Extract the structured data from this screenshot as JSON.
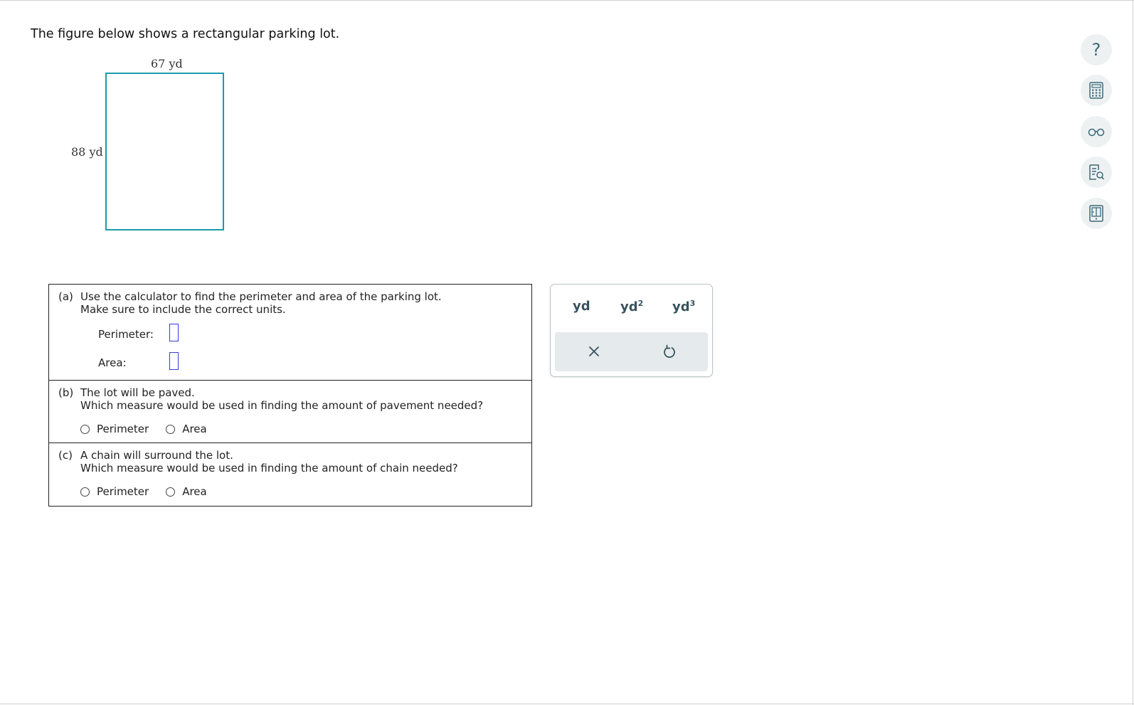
{
  "question": {
    "intro": "The figure below shows a rectangular parking lot."
  },
  "figure": {
    "width_label": "67 yd",
    "length_label": "88 yd",
    "border_color": "#1a9bb0"
  },
  "part_a": {
    "tag": "(a)",
    "line1": "Use the calculator to find the perimeter and area of the parking lot.",
    "line2": "Make sure to include the correct units.",
    "perimeter_label": "Perimeter:",
    "perimeter_value": "",
    "area_label": "Area:",
    "area_value": ""
  },
  "part_b": {
    "tag": "(b)",
    "line1": "The lot will be paved.",
    "line2": "Which measure would be used in finding the amount of pavement needed?",
    "options": [
      "Perimeter",
      "Area"
    ]
  },
  "part_c": {
    "tag": "(c)",
    "line1": "A chain will surround the lot.",
    "line2": "Which measure would be used in finding the amount of chain needed?",
    "options": [
      "Perimeter",
      "Area"
    ]
  },
  "unit_panel": {
    "units": [
      {
        "base": "yd",
        "exp": ""
      },
      {
        "base": "yd",
        "exp": "2"
      },
      {
        "base": "yd",
        "exp": "3"
      }
    ],
    "actions": [
      "clear-icon",
      "undo-icon"
    ]
  },
  "toolbar": {
    "help_glyph": "?",
    "icons": [
      "help-icon",
      "calculator-icon",
      "glasses-icon",
      "notes-icon",
      "textbook-icon"
    ]
  },
  "colors": {
    "input_border": "#3a3adb",
    "unit_text": "#38535e",
    "icon": "#3b6b7a"
  }
}
